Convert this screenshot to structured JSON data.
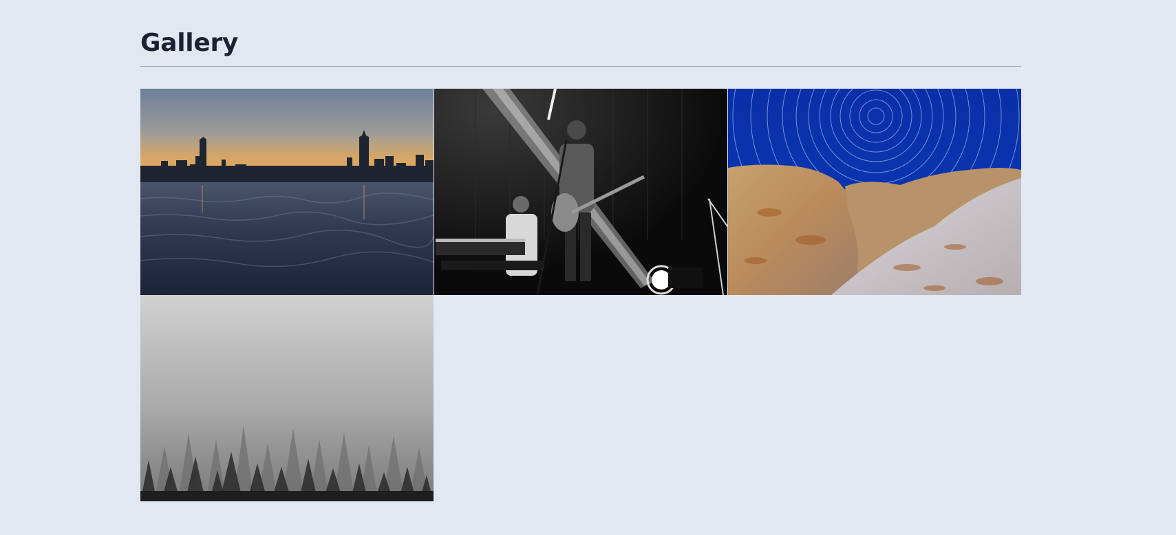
{
  "page": {
    "title": "Gallery"
  },
  "gallery": {
    "images": [
      {
        "name": "city-skyline-image"
      },
      {
        "name": "concert-stage-image"
      },
      {
        "name": "star-trails-image"
      },
      {
        "name": "foggy-forest-image"
      }
    ]
  },
  "colors": {
    "background": "#e2e8f1",
    "title": "#1c2230",
    "rule": "#9ba6b6"
  }
}
